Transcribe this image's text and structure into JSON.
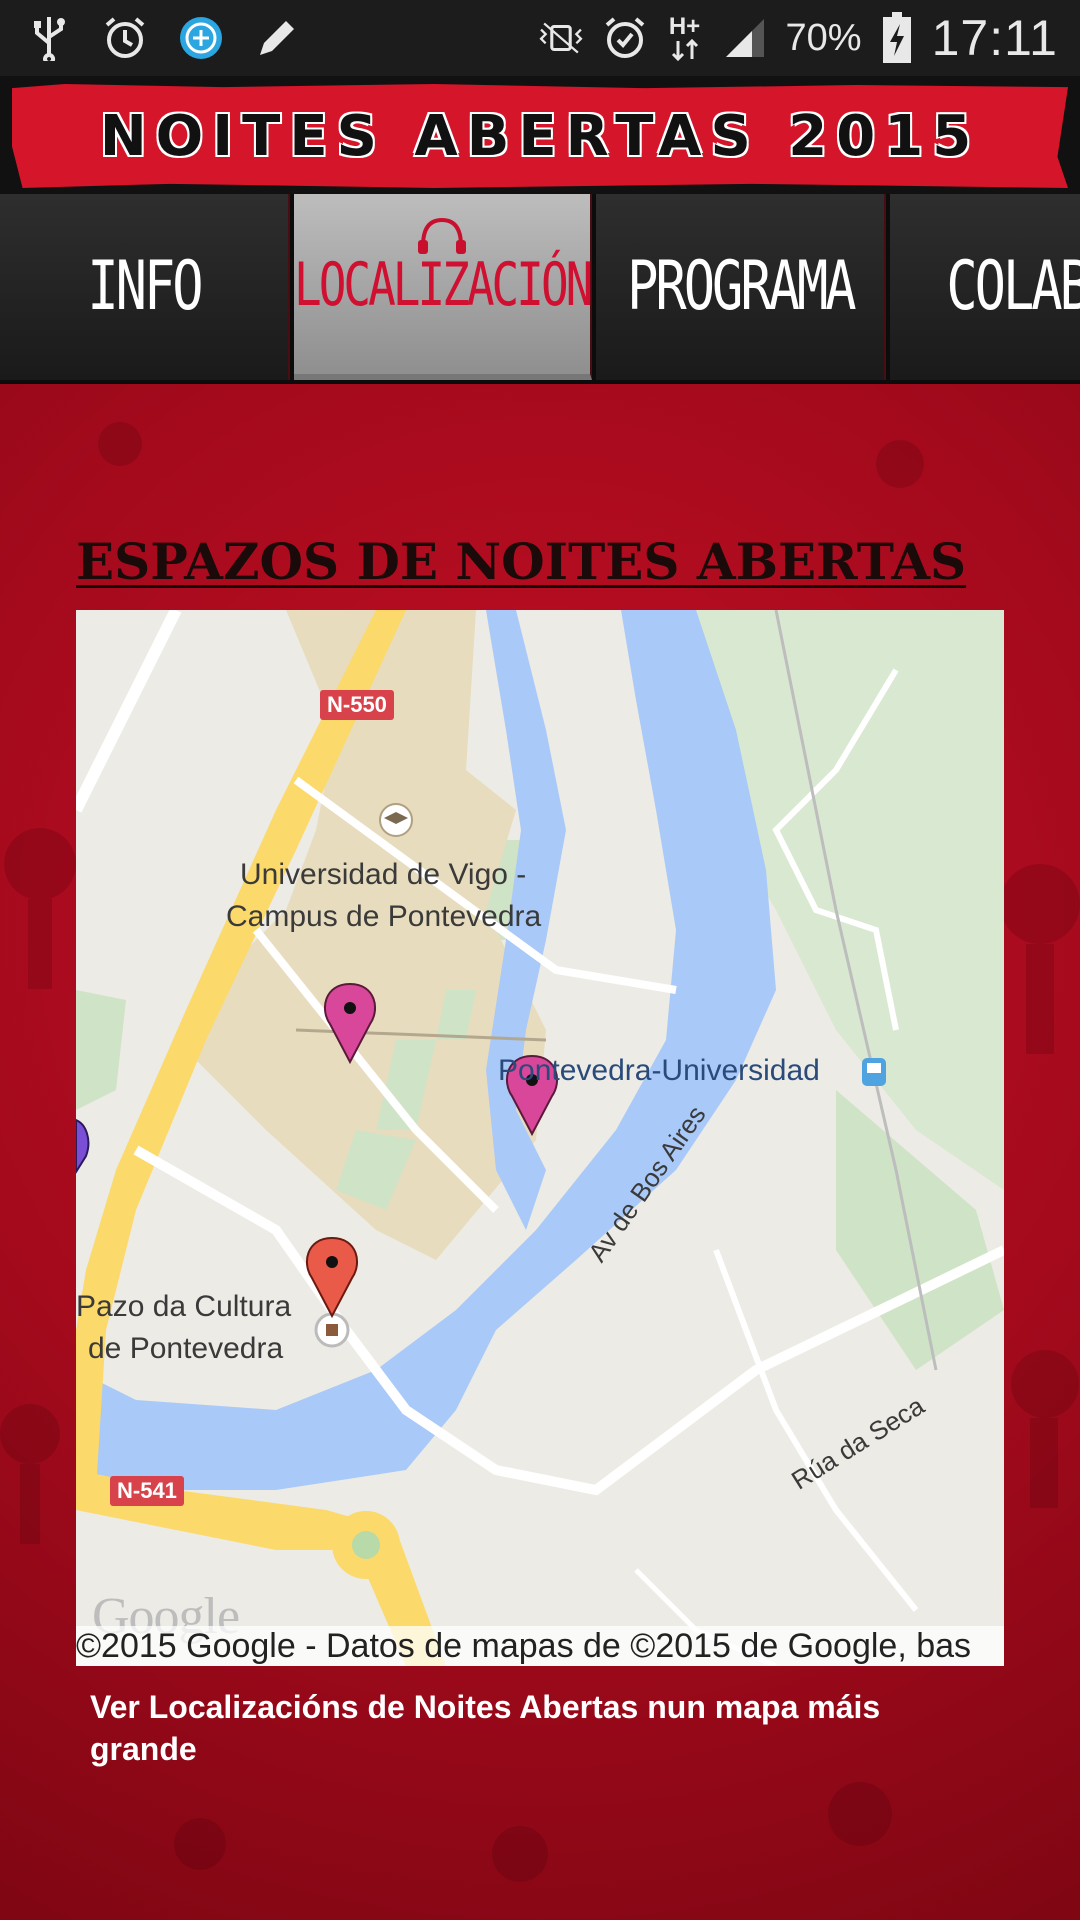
{
  "status_bar": {
    "battery": "70%",
    "time": "17:11",
    "network": "H+",
    "left_icons": [
      "usb-icon",
      "alarm-icon",
      "add-circle-icon",
      "pencil-icon"
    ],
    "right_icons": [
      "vibrate-mute-icon",
      "alarm-icon",
      "data-arrows-icon",
      "signal-icon",
      "battery-charging-icon"
    ]
  },
  "banner": {
    "title": "NOITES ABERTAS 2015"
  },
  "tabs": [
    {
      "label": "INFO",
      "active": false
    },
    {
      "label": "LOCALIZACIÓN",
      "active": true
    },
    {
      "label": "PROGRAMA",
      "active": false
    },
    {
      "label": "COLABOR",
      "active": false
    }
  ],
  "content": {
    "section_title": "ESPAZOS DE NOITES ABERTAS",
    "map_link": "Ver Localizacións de Noites Abertas nun mapa máis grande"
  },
  "map": {
    "labels": {
      "university_line1": "Universidad de Vigo -",
      "university_line2": "Campus de Pontevedra",
      "station": "Pontevedra-Universidad",
      "pazo_line1": "Pazo da Cultura",
      "pazo_line2": "de Pontevedra",
      "street1": "Av de Bos Aires",
      "street2": "Rúa da Seca"
    },
    "road_badges": {
      "north": "N-550",
      "south": "N-541"
    },
    "google_logo": "Google",
    "attribution": "©2015 Google - Datos de mapas de ©2015 de Google, bas",
    "colors": {
      "water": "#a9c9f8",
      "campus": "#e8dcbf",
      "park": "#cfe3c6",
      "highway": "#fbd96a",
      "pin_pink": "#d9479a",
      "pin_red": "#ea5a48"
    }
  }
}
